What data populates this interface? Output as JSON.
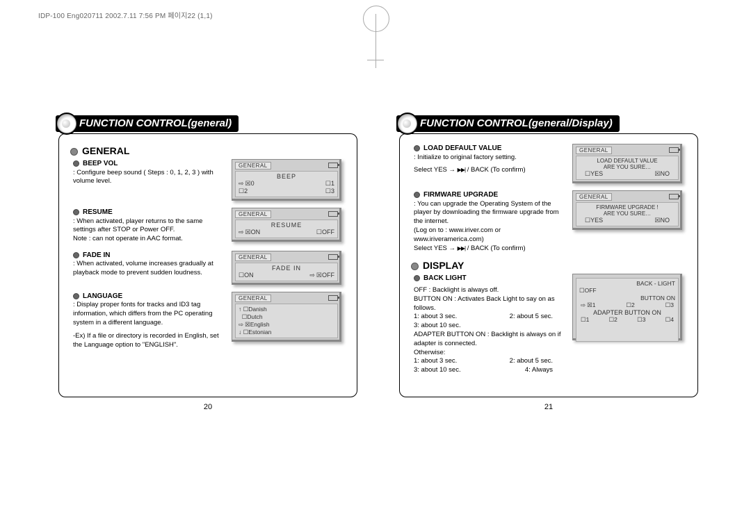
{
  "running_header": "IDP-100 Eng020711  2002.7.11 7:56 PM  페이지22 (1,1)",
  "left": {
    "heading": "FUNCTION CONTROL(general)",
    "section": "GENERAL",
    "items": {
      "beep": {
        "title": "BEEP VOL",
        "body": ": Configure beep sound ( Steps : 0, 1, 2, 3 ) with volume level.",
        "lcd_tab": "GENERAL",
        "lcd_title": "BEEP",
        "opt0": "0",
        "opt1": "1",
        "opt2": "2",
        "opt3": "3"
      },
      "resume": {
        "title": "RESUME",
        "body": ": When activated, player returns to the same settings after STOP or Power OFF.",
        "note": "Note : can not operate in AAC format.",
        "lcd_tab": "GENERAL",
        "lcd_title": "RESUME",
        "on": "ON",
        "off": "OFF"
      },
      "fade": {
        "title": "FADE IN",
        "body": ": When activated, volume increases gradually at playback mode to prevent sudden loudness.",
        "lcd_tab": "GENERAL",
        "lcd_title": "FADE IN",
        "on": "ON",
        "off": "OFF"
      },
      "lang": {
        "title": "LANGUAGE",
        "body": ": Display proper fonts for tracks and ID3 tag information, which differs from the PC operating system in a different language.",
        "ex": "-Ex) If a file or directory is recorded in English, set the Language option to \"ENGLISH\".",
        "lcd_tab": "GENERAL",
        "l1": "Danish",
        "l2": "Dutch",
        "l3": "English",
        "l4": "Estonian"
      }
    },
    "page_number": "20"
  },
  "right": {
    "heading": "FUNCTION CONTROL(general/Display)",
    "items": {
      "load": {
        "title": "LOAD DEFAULT VALUE",
        "body": ": Initialize to original factory setting.",
        "confirm_a": "Select YES → ",
        "confirm_b": " / BACK (To confirm)",
        "lcd_tab": "GENERAL",
        "lcd_l1": "LOAD DEFAULT VALUE",
        "lcd_l2": "ARE YOU SURE…",
        "yes": "YES",
        "no": "NO"
      },
      "fw": {
        "title": "FIRMWARE UPGRADE",
        "body": ": You can upgrade the Operating System of the player by downloading the firmware upgrade from the internet.",
        "paren": "(Log on to : www.iriver.com or www.iriveramerica.com)",
        "confirm_a": "Select YES → ",
        "confirm_b": " / BACK (To confirm)",
        "lcd_tab": "GENERAL",
        "lcd_l1": "FIRMWARE UPGRADE !",
        "lcd_l2": "ARE YOU SURE…",
        "yes": "YES",
        "no": "NO"
      }
    },
    "section": "DISPLAY",
    "backlight": {
      "title": "BACK LIGHT",
      "off": "OFF : Backlight is always off.",
      "btn_on": "BUTTON ON : Activates Back Light to say on as follows.",
      "t1": "1: about 3 sec.",
      "t2": "2: about 5 sec.",
      "t3": "3: about 10 sec.",
      "adapter": "ADAPTER BUTTON ON : Backlight is always on if adapter is connected.",
      "otherwise": "Otherwise:",
      "u1": "1: about 3 sec.",
      "u2": "2: about 5 sec.",
      "u3": "3: about 10 sec.",
      "u4": "4: Always",
      "lcd_title": "BACK - LIGHT",
      "lcd_off": "OFF",
      "lcd_btn": "BUTTON ON",
      "lcd_adapter": "ADAPTER BUTTON ON",
      "n1": "1",
      "n2": "2",
      "n3": "3",
      "n4": "4"
    },
    "page_number": "21"
  }
}
